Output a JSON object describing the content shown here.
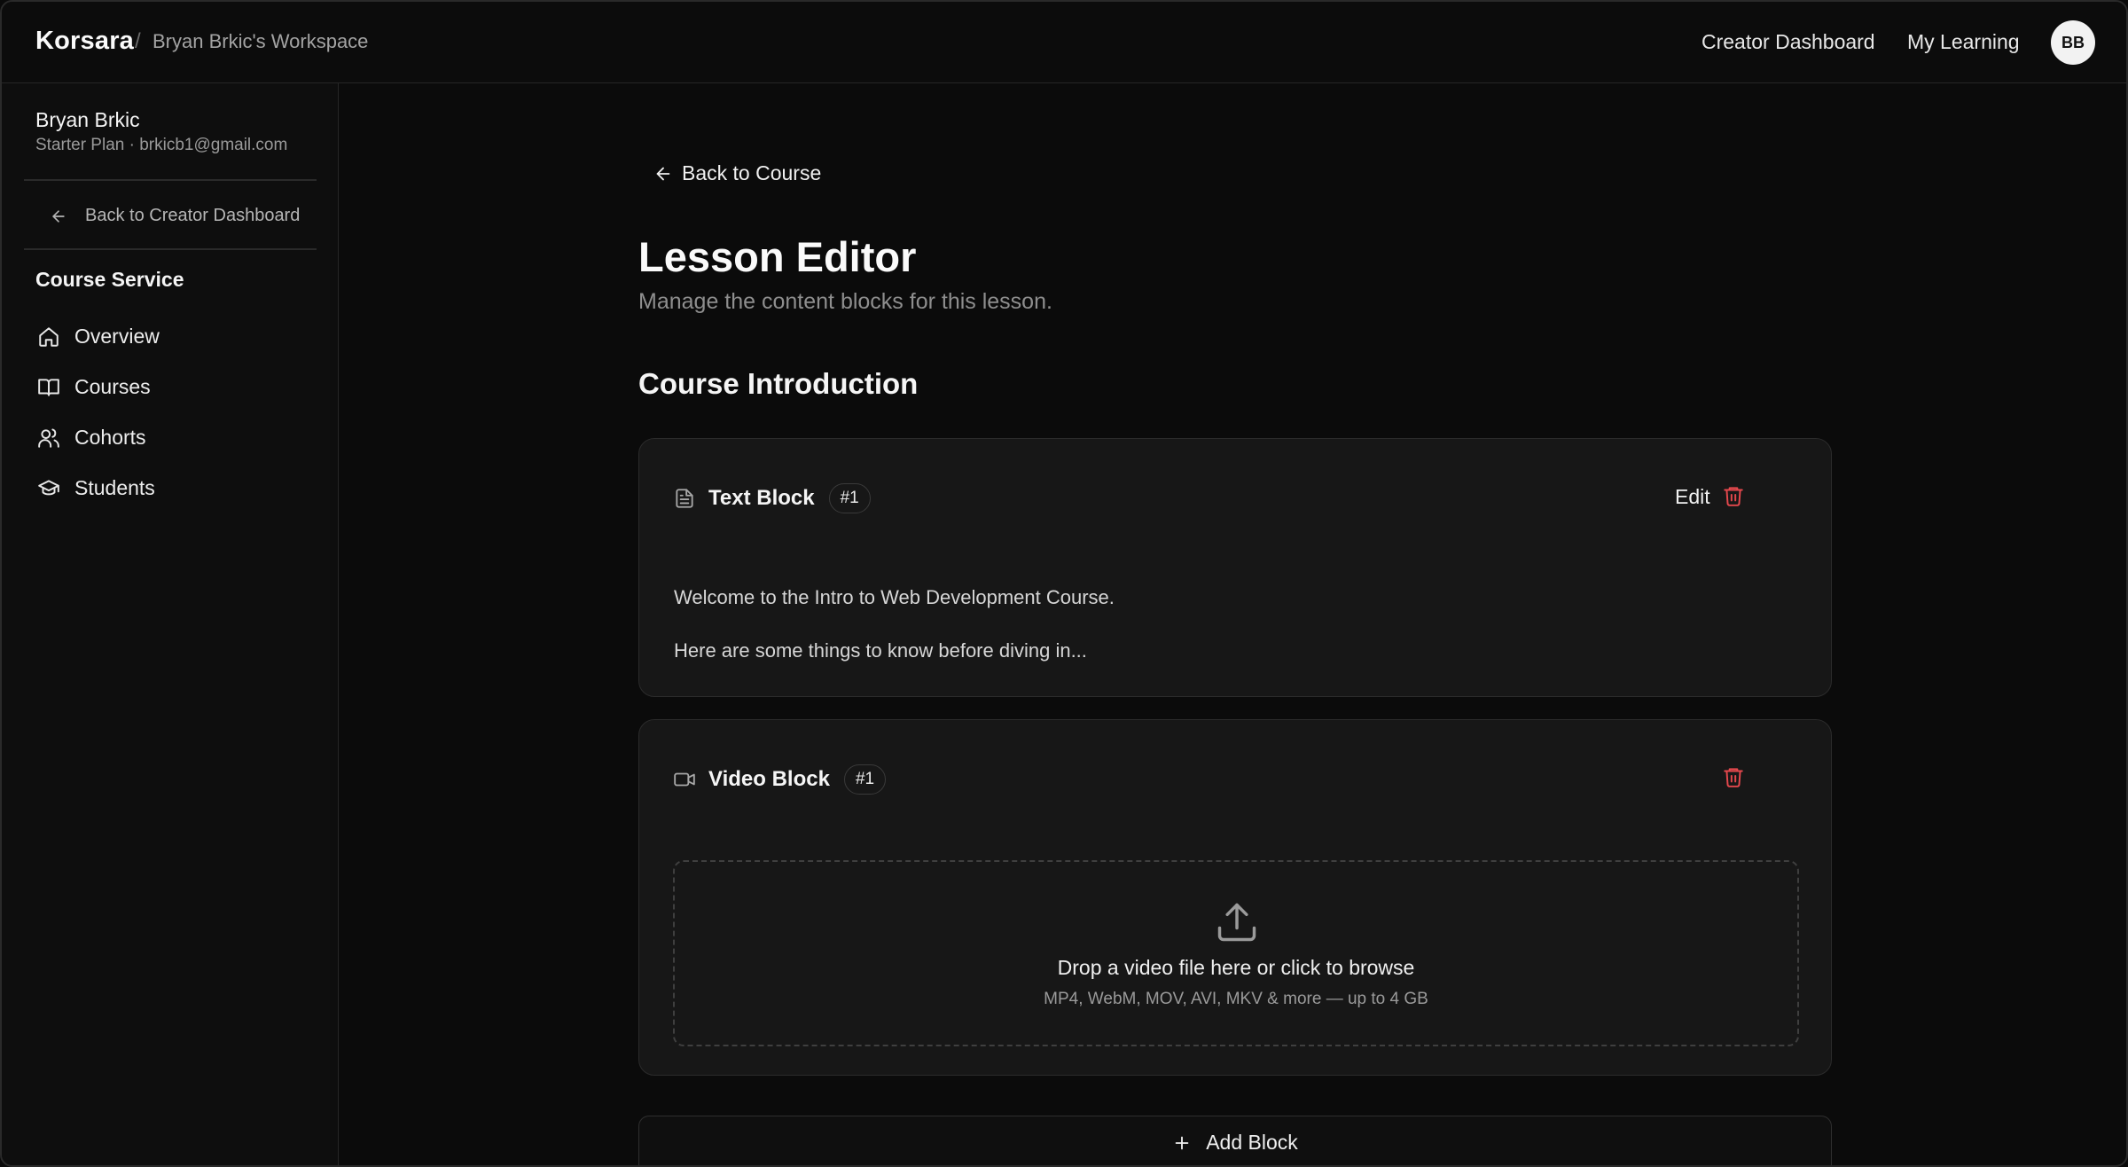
{
  "topbar": {
    "brand": "Korsara",
    "separator": "/",
    "workspace": "Bryan Brkic's Workspace",
    "nav": {
      "creator_dashboard": "Creator Dashboard",
      "my_learning": "My Learning"
    },
    "avatar_initials": "BB"
  },
  "sidebar": {
    "user_name": "Bryan Brkic",
    "user_plan": "Starter Plan · brkicb1@gmail.com",
    "back_link": "Back to Creator Dashboard",
    "section_title": "Course Service",
    "items": [
      {
        "label": "Overview",
        "icon": "home-icon"
      },
      {
        "label": "Courses",
        "icon": "book-icon"
      },
      {
        "label": "Cohorts",
        "icon": "users-icon"
      },
      {
        "label": "Students",
        "icon": "graduation-cap-icon"
      }
    ]
  },
  "main": {
    "back_link": "Back to Course",
    "title": "Lesson Editor",
    "subtitle": "Manage the content blocks for this lesson.",
    "lesson_title": "Course Introduction",
    "blocks": [
      {
        "type_label": "Text Block",
        "badge": "#1",
        "icon": "document-icon",
        "edit_label": "Edit",
        "lines": [
          "Welcome to the Intro to Web Development Course.",
          "Here are some things to know before diving in..."
        ]
      },
      {
        "type_label": "Video Block",
        "badge": "#1",
        "icon": "video-icon",
        "dropzone": {
          "title": "Drop a video file here or click to browse",
          "subtitle": "MP4, WebM, MOV, AVI, MKV & more — up to 4 GB"
        }
      }
    ],
    "add_block_label": "Add Block"
  },
  "colors": {
    "background": "#0b0b0b",
    "card": "#171717",
    "danger": "#e5484d",
    "text": "#f2f2f2",
    "muted": "#9a9a9a"
  }
}
